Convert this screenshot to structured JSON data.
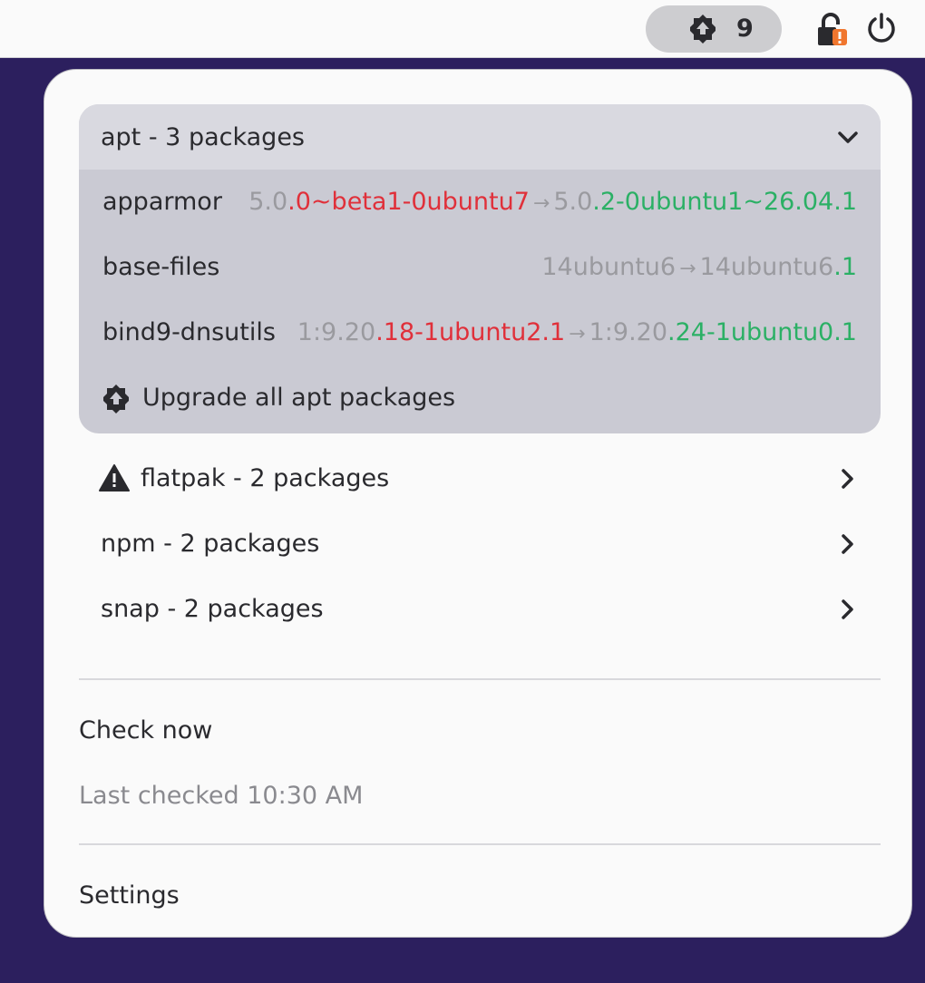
{
  "topbar": {
    "updates_icon": "package-upgrade-icon",
    "update_count": "9",
    "lock_icon": "unlocked-warning-icon",
    "power_icon": "power-icon"
  },
  "apt": {
    "title": "apt - 3 packages",
    "expand_icon": "chevron-down-icon",
    "packages": [
      {
        "name": "apparmor",
        "old_common": "5.0",
        "old_diff": ".0~beta1-0ubuntu7",
        "new_common": "5.0",
        "new_diff": ".2-0ubuntu1~26.04.1"
      },
      {
        "name": "base-files",
        "old_common": "14ubuntu6",
        "old_diff": "",
        "new_common": "14ubuntu6",
        "new_diff": ".1"
      },
      {
        "name": "bind9-dnsutils",
        "old_common": "1:9.20",
        "old_diff": ".18-1ubuntu2.1",
        "new_common": "1:9.20",
        "new_diff": ".24-1ubuntu0.1"
      }
    ],
    "arrow": "→",
    "upgrade_label": "Upgrade all apt packages"
  },
  "sources": [
    {
      "label": "flatpak - 2 packages",
      "icon": "warning-icon"
    },
    {
      "label": "npm - 2 packages"
    },
    {
      "label": "snap - 2 packages"
    }
  ],
  "actions": {
    "check_now": "Check now",
    "last_checked": "Last checked 10:30 AM",
    "settings": "Settings"
  },
  "colors": {
    "old_version": "#e0303a",
    "new_version": "#2bb065",
    "accent_lock": "#f0762e"
  }
}
